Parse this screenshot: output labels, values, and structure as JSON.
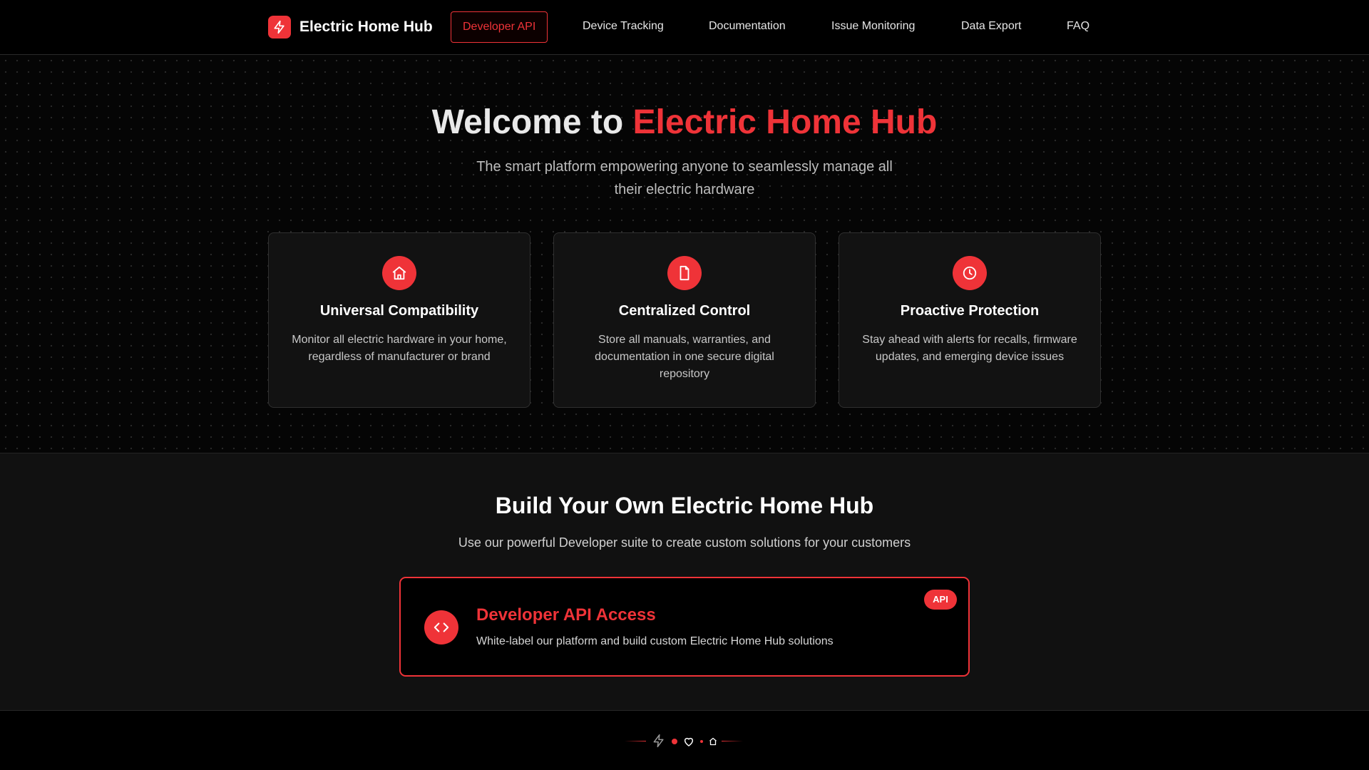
{
  "brand": {
    "name": "Electric Home Hub",
    "logo_icon": "bolt-icon"
  },
  "nav": {
    "items": [
      {
        "label": "Developer API",
        "active": true
      },
      {
        "label": "Device Tracking",
        "active": false
      },
      {
        "label": "Documentation",
        "active": false
      },
      {
        "label": "Issue Monitoring",
        "active": false
      },
      {
        "label": "Data Export",
        "active": false
      },
      {
        "label": "FAQ",
        "active": false
      }
    ]
  },
  "hero": {
    "title_prefix": "Welcome to ",
    "title_accent": "Electric Home Hub",
    "subtitle": "The smart platform empowering anyone to seamlessly manage all their electric hardware"
  },
  "features": [
    {
      "icon": "home-icon",
      "title": "Universal Compatibility",
      "text": "Monitor all electric hardware in your home, regardless of manufacturer or brand"
    },
    {
      "icon": "document-icon",
      "title": "Centralized Control",
      "text": "Store all manuals, warranties, and documentation in one secure digital repository"
    },
    {
      "icon": "clock-icon",
      "title": "Proactive Protection",
      "text": "Stay ahead with alerts for recalls, firmware updates, and emerging device issues"
    }
  ],
  "developer": {
    "title": "Build Your Own Electric Home Hub",
    "subtitle": "Use our powerful Developer suite to create custom solutions for your customers",
    "api_card": {
      "icon": "code-icon",
      "title": "Developer API Access",
      "text": "White-label our platform and build custom Electric Home Hub solutions",
      "badge": "API"
    }
  },
  "footer": {
    "icons": [
      "bolt-icon",
      "heart-icon",
      "home-icon"
    ]
  },
  "colors": {
    "accent": "#ef3338",
    "background": "#000000",
    "section": "#111111"
  }
}
